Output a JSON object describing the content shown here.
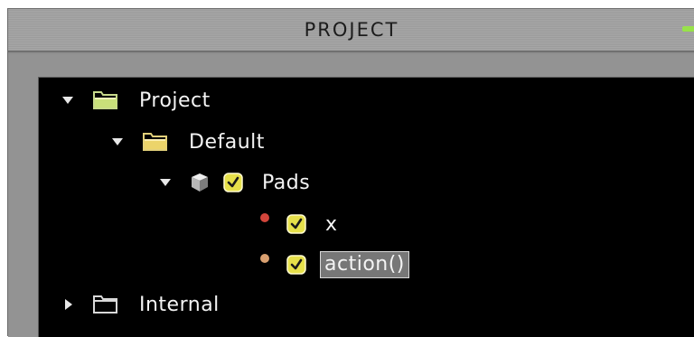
{
  "panel": {
    "title": "PROJECT"
  },
  "tree": {
    "nodes": [
      {
        "label": "Project",
        "expanded": true,
        "icon": "folder-open-icon"
      },
      {
        "label": "Default",
        "expanded": true,
        "icon": "folder-open-icon"
      },
      {
        "label": "Pads",
        "expanded": true,
        "icon": "cube-icon",
        "checked": true
      },
      {
        "label": "x",
        "checked": true,
        "dot_color": "#d2453b"
      },
      {
        "label": "action()",
        "checked": true,
        "dot_color": "#d9a070",
        "selected": true
      },
      {
        "label": "Internal",
        "expanded": false,
        "icon": "folder-closed-icon"
      }
    ]
  },
  "colors": {
    "accent_green": "#98e24a",
    "check_yellow": "#e6e04a",
    "folder_yellow": "#e8e07a"
  }
}
